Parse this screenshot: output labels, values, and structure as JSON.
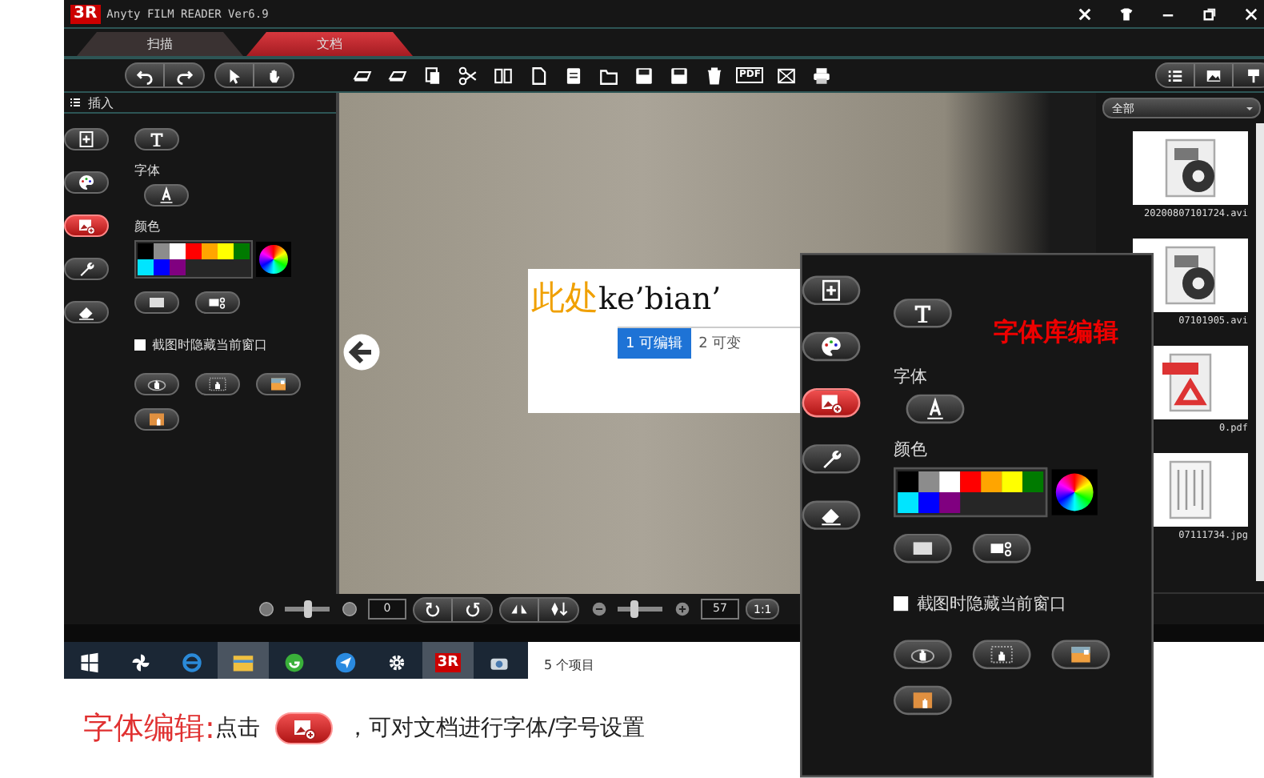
{
  "window": {
    "logo": "3R",
    "title": "Anyty FILM READER Ver6.9"
  },
  "tabs": [
    {
      "label": "扫描",
      "selected": false
    },
    {
      "label": "文档",
      "selected": true
    }
  ],
  "toolbar": {
    "pdf_label": "PDF"
  },
  "insert_panel": {
    "header": "插入",
    "tools": [
      {
        "kind": "insert",
        "selected": false
      },
      {
        "kind": "palette",
        "selected": false
      },
      {
        "kind": "picture",
        "selected": true
      },
      {
        "kind": "wrench",
        "selected": false
      },
      {
        "kind": "eraser",
        "selected": false
      }
    ],
    "font_label": "字体",
    "color_label": "颜色",
    "swatches": [
      {
        "color": "#000000"
      },
      {
        "color": "#8c8c8c"
      },
      {
        "color": "#ffffff"
      },
      {
        "color": "#ff0000"
      },
      {
        "color": "#ffa500"
      },
      {
        "color": "#ffff00"
      },
      {
        "color": "#007a00"
      },
      {
        "color": "#00e5ff"
      },
      {
        "color": "#0000ff"
      },
      {
        "color": "#800080"
      }
    ],
    "hide_window": {
      "label": "截图时隐藏当前窗口",
      "checked": false
    }
  },
  "document": {
    "edit_box": {
      "prefix": "此处",
      "typed": "ke’bian’",
      "candidates": [
        {
          "index": "1",
          "text": "可编辑",
          "selected": true
        },
        {
          "index": "2",
          "text": "可变",
          "selected": false
        }
      ]
    }
  },
  "files": {
    "filter": "全部",
    "items": [
      {
        "name": "20200807101724.avi",
        "kind": "video"
      },
      {
        "name": "07101905.avi",
        "kind": "video"
      },
      {
        "name": "0.pdf",
        "kind": "pdf"
      },
      {
        "name": "07111734.jpg",
        "kind": "image"
      }
    ]
  },
  "bottom_bar": {
    "brightness": {
      "level": 0.5
    },
    "rotation": "0",
    "zoom": {
      "level": 0.35
    },
    "zoom_value": "57",
    "fit_label": "1:1"
  },
  "taskbar": {
    "app_label": "3R",
    "status": "5 个项目"
  },
  "popup": {
    "title": "字体库编辑",
    "tools": [
      {
        "kind": "insert",
        "selected": false
      },
      {
        "kind": "palette",
        "selected": false
      },
      {
        "kind": "picture",
        "selected": true
      },
      {
        "kind": "wrench",
        "selected": false
      },
      {
        "kind": "eraser",
        "selected": false
      }
    ],
    "font_label": "字体",
    "color_label": "颜色",
    "swatches": [
      {
        "color": "#000000"
      },
      {
        "color": "#8c8c8c"
      },
      {
        "color": "#ffffff"
      },
      {
        "color": "#ff0000"
      },
      {
        "color": "#ffa500"
      },
      {
        "color": "#ffff00"
      },
      {
        "color": "#007a00"
      },
      {
        "color": "#00e5ff"
      },
      {
        "color": "#0000ff"
      },
      {
        "color": "#800080"
      }
    ],
    "hide_window": {
      "label": "截图时隐藏当前窗口",
      "checked": false
    }
  },
  "caption": {
    "title": "字体编辑:",
    "before": "点击",
    "after": "，可对文档进行字体/字号设置"
  }
}
